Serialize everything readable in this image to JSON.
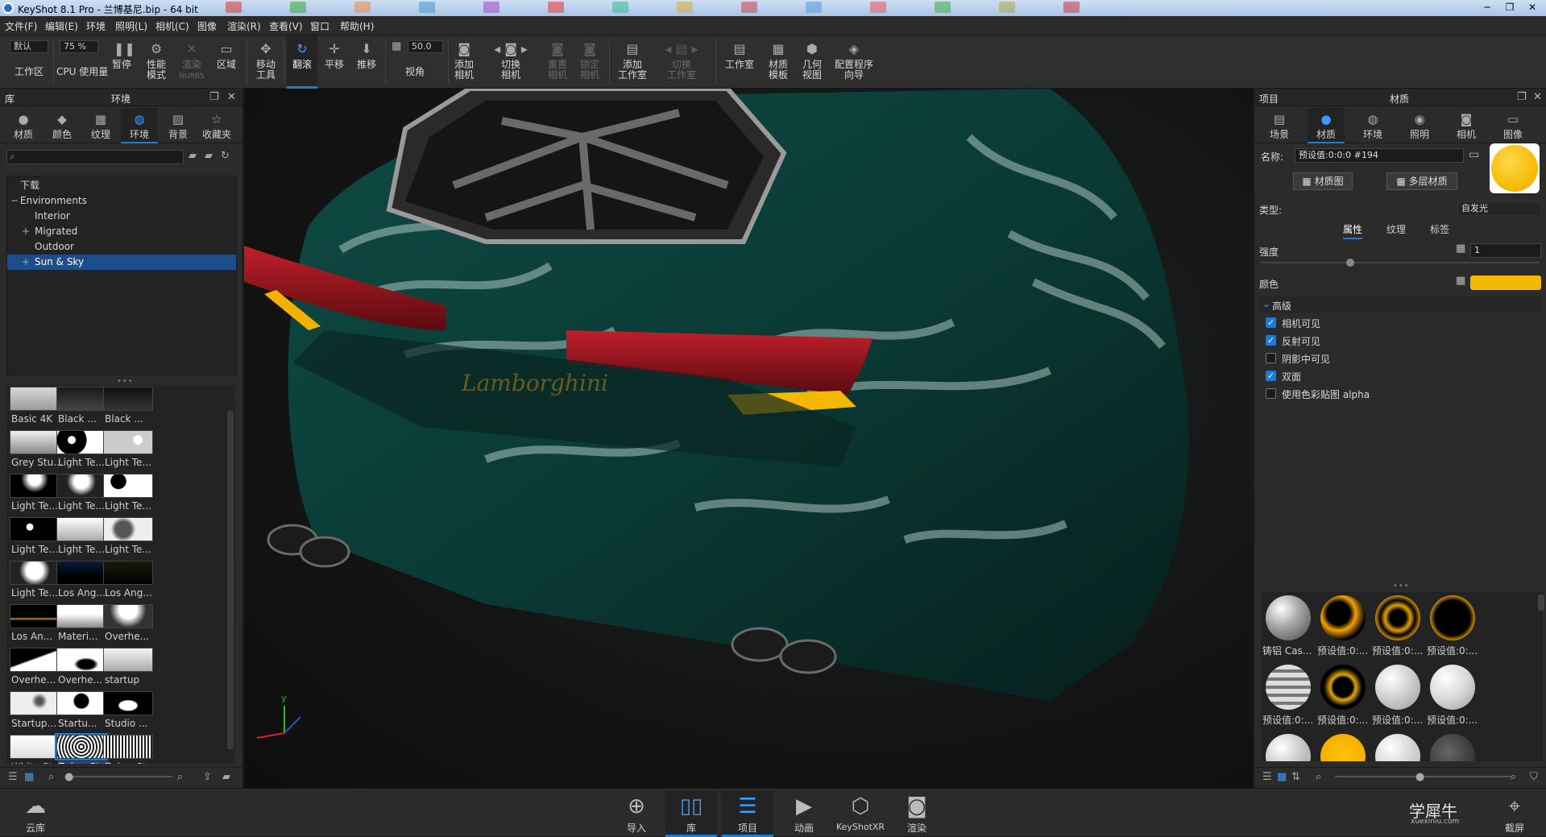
{
  "window": {
    "title": "KeyShot 8.1 Pro - 兰博基尼.bip - 64 bit",
    "controls": {
      "minimize": "─",
      "restore": "❐",
      "close": "✕"
    }
  },
  "menu": [
    "文件(F)",
    "编辑(E)",
    "环境",
    "照明(L)",
    "相机(C)",
    "图像",
    "渲染(R)",
    "查看(V)",
    "窗口",
    "帮助(H)"
  ],
  "toolbar": {
    "workspace_value": "默认",
    "workspace_label": "工作区",
    "cpu_value": "75 %",
    "cpu_label": "CPU 使用量",
    "pause": "暂停",
    "perf_line1": "性能",
    "perf_line2": "模式",
    "denoise_line1": "渲染",
    "denoise_line2": "NURBS",
    "region": "区域",
    "move_line1": "移动",
    "move_line2": "工具",
    "tumble": "翻滚",
    "pan": "平移",
    "dolly": "推移",
    "fov_value": "50.0",
    "fov_label": "视角",
    "addcam_line1": "添加",
    "addcam_line2": "相机",
    "switchcam_line1": "切换",
    "switchcam_line2": "相机",
    "resetcam_line1": "重置",
    "resetcam_line2": "相机",
    "lockcam_line1": "锁定",
    "lockcam_line2": "相机",
    "addstudio_line1": "添加",
    "addstudio_line2": "工作室",
    "switchstudio_line1": "切换",
    "switchstudio_line2": "工作室",
    "studio": "工作室",
    "mattpl_line1": "材质",
    "mattpl_line2": "模板",
    "geom_line1": "几何",
    "geom_line2": "视图",
    "config_line1": "配置程序",
    "config_line2": "向导"
  },
  "library": {
    "title": "库",
    "subtitle": "环境",
    "tabs": [
      "材质",
      "颜色",
      "纹理",
      "环境",
      "背景",
      "收藏夹"
    ],
    "active_tab": "环境",
    "search_placeholder": "",
    "tree": [
      {
        "label": "下载",
        "indent": 0
      },
      {
        "label": "Environments",
        "indent": 0,
        "toggle": "−"
      },
      {
        "label": "Interior",
        "indent": 1
      },
      {
        "label": "Migrated",
        "indent": 1,
        "toggle": "+"
      },
      {
        "label": "Outdoor",
        "indent": 1
      },
      {
        "label": "Sun & Sky",
        "indent": 1,
        "toggle": "+",
        "selected": true
      }
    ],
    "thumbnails": [
      {
        "label": "Basic 4K",
        "style": "linear-gradient(#d8d8d8,#9a9a9a)"
      },
      {
        "label": "Black ...",
        "style": "linear-gradient(#1a1a1a,#444)"
      },
      {
        "label": "Black ...",
        "style": "linear-gradient(#111,#333)"
      },
      {
        "label": "Grey Stu...",
        "style": "linear-gradient(#f0f0f0,#888)"
      },
      {
        "label": "Light Te...",
        "style": "radial-gradient(circle at 30% 40%, #fff 10%, #000 12%, #000 40%, #fff 42%)"
      },
      {
        "label": "Light Te...",
        "style": "radial-gradient(circle at 70% 40%, #fff 12%, #ccc 14%)"
      },
      {
        "label": "Light Te...",
        "style": "radial-gradient(circle at 50% 20%, #fff 20%, #000 45%)"
      },
      {
        "label": "Light Te...",
        "style": "radial-gradient(circle at 50% 30%, #fff 25%, #222 50%)"
      },
      {
        "label": "Light Te...",
        "style": "radial-gradient(circle at 30% 30%, #000 20%, #fff 22%)"
      },
      {
        "label": "Light Te...",
        "style": "radial-gradient(circle at 40% 40%, #fff 10%, #000 12%)"
      },
      {
        "label": "Light Te...",
        "style": "linear-gradient(#fff,#aaa)"
      },
      {
        "label": "Light Te...",
        "style": "radial-gradient(circle at 40% 50%, #555 25%, #eee 40%)"
      },
      {
        "label": "Light Te...",
        "style": "radial-gradient(circle at 50% 40%, #fff 30%, #222 55%)"
      },
      {
        "label": "Los Ang...",
        "style": "linear-gradient(#0b1a3a,#000 70%)"
      },
      {
        "label": "Los Ang...",
        "style": "linear-gradient(#1a1a0a,#000)"
      },
      {
        "label": "Los An...",
        "style": "linear-gradient(#000 55%,#c08a20 60%,#000 70%)"
      },
      {
        "label": "Materi...",
        "style": "linear-gradient(#fff 40%,#888)"
      },
      {
        "label": "Overhe...",
        "style": "radial-gradient(circle at 50% 20%, #fff 30%, #333 60%)"
      },
      {
        "label": "Overhe...",
        "style": "linear-gradient(160deg,#000 45%,#fff 50%)"
      },
      {
        "label": "Overhe...",
        "style": "radial-gradient(ellipse at 60% 70%, #000 20%, #fff 30%)"
      },
      {
        "label": "startup",
        "style": "linear-gradient(#f5f5f5,#aaa)"
      },
      {
        "label": "Startup...",
        "style": "radial-gradient(circle at 60% 40%, #555 10%, #eee 25%)"
      },
      {
        "label": "Startu...",
        "style": "radial-gradient(circle at 50% 40%, #000 25%, #fff 30%)"
      },
      {
        "label": "Studio ...",
        "style": "radial-gradient(ellipse at 50% 60%, #fff 25%, #000 30%)"
      },
      {
        "label": "White St...",
        "style": "linear-gradient(#fff,#e0e0e0)"
      },
      {
        "label": "Zebra St...",
        "style": "repeating-radial-gradient(circle at 50% 50%, #fff 0 2px, #222 2px 4px)",
        "selected": true
      },
      {
        "label": "Zebra St...",
        "style": "repeating-linear-gradient(90deg,#fff 0 2px,#222 2px 4px)"
      }
    ]
  },
  "properties": {
    "title": "项目",
    "subtitle": "材质",
    "tabs": [
      "场景",
      "材质",
      "环境",
      "照明",
      "相机",
      "图像"
    ],
    "active_tab": "材质",
    "name_label": "名称:",
    "name_value": "预设值:0:0:0 #194",
    "btn_material_graph": "材质图",
    "btn_multi_material": "多层材质",
    "type_label": "类型:",
    "type_value": "自发光",
    "subtabs": [
      "属性",
      "纹理",
      "标签"
    ],
    "active_subtab": "属性",
    "intensity_label": "强度",
    "intensity_value": "1",
    "intensity_fraction": 0.32,
    "color_label": "颜色",
    "color_hex": "#f5b800",
    "advanced_label": "高级",
    "checks": [
      {
        "label": "相机可见",
        "checked": true
      },
      {
        "label": "反射可见",
        "checked": true
      },
      {
        "label": "阴影中可见",
        "checked": false
      },
      {
        "label": "双面",
        "checked": true
      },
      {
        "label": "使用色彩贴图 alpha",
        "checked": false
      }
    ],
    "materials": [
      {
        "label": "铸铝 Cas...",
        "style": "radial-gradient(circle at 35% 30%, #fff, #aaa 40%, #555 90%)"
      },
      {
        "label": "预设值:0:...",
        "style": "radial-gradient(circle at 40% 40%, #000 30%, #f2a100 45%, #000 70%)"
      },
      {
        "label": "预设值:0:...",
        "style": "radial-gradient(circle at 50% 50%, #000 25%, #e0a000 40%, #000 55%, #c88a00 70%)"
      },
      {
        "label": "预设值:0:...",
        "style": "radial-gradient(circle at 50% 50%, #000 55%, #c88a00 70%, #000 85%)"
      },
      {
        "label": "预设值:0:...",
        "style": "repeating-linear-gradient(#ddd 0 6px,#777 6px 10px)"
      },
      {
        "label": "预设值:0:...",
        "style": "radial-gradient(circle at 50% 50%, #000 30%, #e6a800 40%, #000 60%)"
      },
      {
        "label": "预设值:0:...",
        "style": "radial-gradient(circle at 35% 30%, #fff, #ccc 50%, #999)"
      },
      {
        "label": "预设值:0:...",
        "style": "radial-gradient(circle at 35% 30%, #fff, #d8d8d8 50%, #999)"
      },
      {
        "label": "",
        "style": "radial-gradient(circle at 35% 30%, #fff, #bbb 60%)"
      },
      {
        "label": "",
        "style": "radial-gradient(circle at 50% 50%, #ffc400, #f2a800)"
      },
      {
        "label": "",
        "style": "radial-gradient(circle at 35% 30%, #fff, #ccc 60%)"
      },
      {
        "label": "",
        "style": "radial-gradient(circle at 40% 40%, #666, #222)"
      }
    ]
  },
  "bottombar": {
    "cloud": "云库",
    "import": "导入",
    "library": "库",
    "project": "项目",
    "animation": "动画",
    "keyshotxr": "KeyShotXR",
    "render": "渲染",
    "screenshot": "截屏",
    "active": "库",
    "watermark_title": "学犀牛",
    "watermark_url": "xuexiniu.com"
  },
  "viewport": {
    "axis_y": "y",
    "car_badge": "Lamborghini"
  }
}
